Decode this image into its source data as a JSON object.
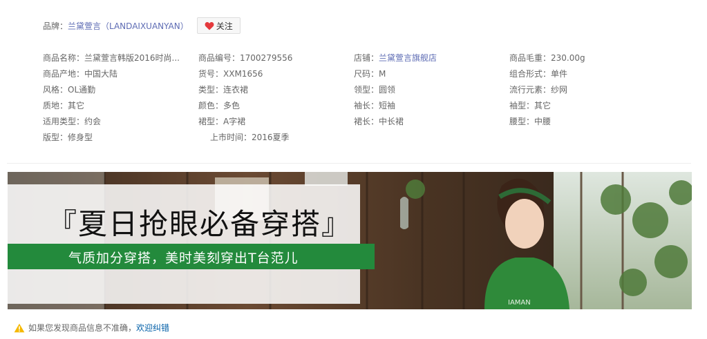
{
  "brand": {
    "label": "品牌：",
    "name": "兰黛萱言（LANDAIXUANYAN）",
    "follow_label": "关注",
    "follow_icon": "heart-icon",
    "heart_color": "#e4393c"
  },
  "attributes": [
    [
      {
        "k": "商品名称：",
        "v": "兰黛萱言韩版2016时尚..."
      },
      {
        "k": "商品编号：",
        "v": "1700279556"
      },
      {
        "k": "店铺：",
        "v": "兰黛萱言旗舰店"
      },
      {
        "k": "商品毛重：",
        "v": "230.00g"
      }
    ],
    [
      {
        "k": "商品产地：",
        "v": "中国大陆"
      },
      {
        "k": "货号：",
        "v": "XXM1656"
      },
      {
        "k": "尺码：",
        "v": "M"
      },
      {
        "k": "组合形式：",
        "v": "单件"
      }
    ],
    [
      {
        "k": "风格：",
        "v": "OL通勤"
      },
      {
        "k": "类型：",
        "v": "连衣裙"
      },
      {
        "k": "领型：",
        "v": "圆领"
      },
      {
        "k": "流行元素：",
        "v": "纱网"
      }
    ],
    [
      {
        "k": "质地：",
        "v": "其它"
      },
      {
        "k": "颜色：",
        "v": "多色"
      },
      {
        "k": "袖长：",
        "v": "短袖"
      },
      {
        "k": "袖型：",
        "v": "其它"
      }
    ],
    [
      {
        "k": "适用类型：",
        "v": "约会"
      },
      {
        "k": "裙型：",
        "v": "A字裙"
      },
      {
        "k": "裙长：",
        "v": "中长裙"
      },
      {
        "k": "腰型：",
        "v": "中腰"
      }
    ],
    [
      {
        "k": "版型：",
        "v": "修身型"
      },
      {
        "k": "上市时间：",
        "v": "2016夏季"
      }
    ]
  ],
  "banner": {
    "headline": "『夏日抢眼必备穿搭』",
    "subline": "气质加分穿搭，美时美刻穿出T台范儿",
    "strip_color": "#238a3c",
    "shirt_print": "IAMAN"
  },
  "notice": {
    "icon": "warning-icon",
    "text": "如果您发现商品信息不准确，",
    "link": "欢迎纠错"
  }
}
